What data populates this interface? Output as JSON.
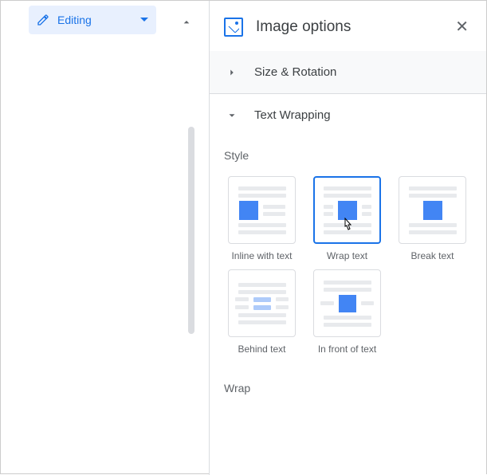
{
  "editing": {
    "label": "Editing"
  },
  "panel": {
    "title": "Image options",
    "sections": {
      "size_rotation": {
        "label": "Size & Rotation"
      },
      "text_wrapping": {
        "label": "Text Wrapping"
      }
    },
    "style_label": "Style",
    "wrap_label": "Wrap",
    "options": [
      {
        "label": "Inline with text"
      },
      {
        "label": "Wrap text"
      },
      {
        "label": "Break text"
      },
      {
        "label": "Behind text"
      },
      {
        "label": "In front of text"
      }
    ]
  }
}
